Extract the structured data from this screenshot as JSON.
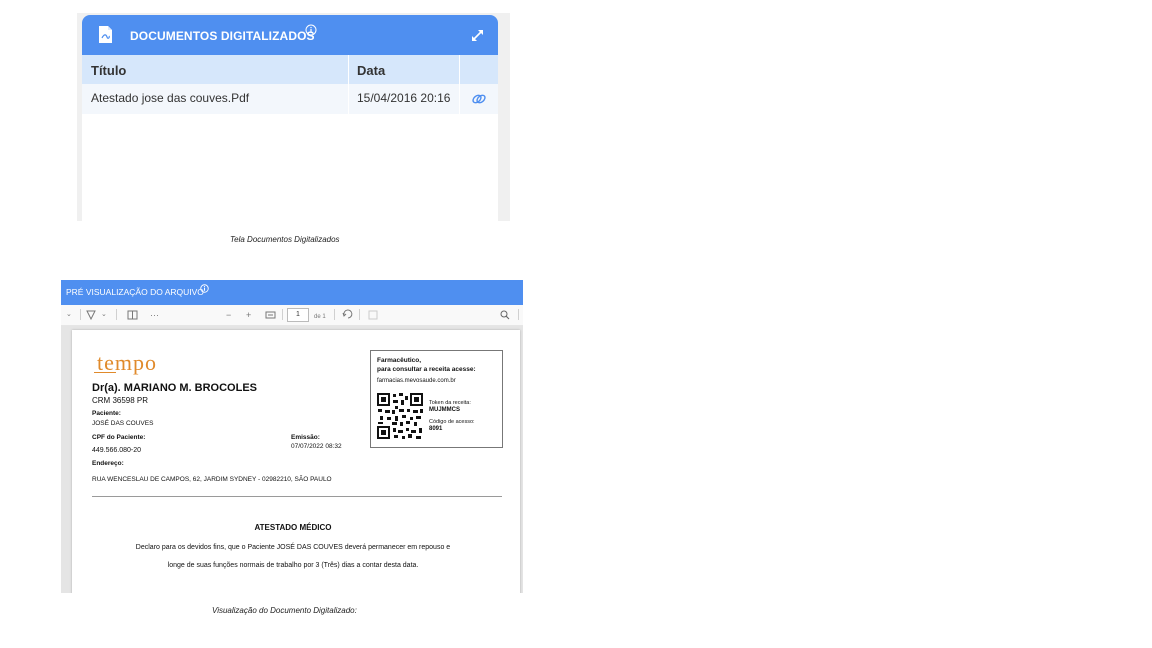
{
  "docs_panel": {
    "title": "DOCUMENTOS DIGITALIZADOS",
    "columns": [
      "Título",
      "Data"
    ],
    "rows": [
      {
        "titulo": "Atestado jose das couves.Pdf",
        "data": "15/04/2016 20:16"
      }
    ],
    "icons": [
      "pdf-file-icon",
      "info-icon",
      "expand-icon",
      "link-icon"
    ],
    "header_color": "#4f8ff0"
  },
  "caption_top": "Tela Documentos Digitalizados",
  "preview": {
    "title": "PRÉ VISUALIZAÇÃO DO ARQUIVO",
    "toolbar": {
      "page_number": "1",
      "page_total": "de 1",
      "minus": "−",
      "plus": "+",
      "more": "···"
    },
    "document": {
      "logo": "tempo",
      "doctor": "Dr(a). MARIANO M. BROCOLES",
      "crm": "CRM 36598 PR",
      "patient_label": "Paciente:",
      "patient": "JOSÉ DAS COUVES",
      "cpf_label": "CPF do Paciente:",
      "cpf": "449.566.080-20",
      "emission_label": "Emissão:",
      "emission": "07/07/2022 08:32",
      "address_label": "Endereço:",
      "address": "RUA WENCESLAU DE CAMPOS, 62, JARDIM SYDNEY - 02982210, SÃO PAULO",
      "pharm_title_1": "Farmacêutico,",
      "pharm_title_2": "para consultar a receita acesse:",
      "pharm_url": "farmacias.mevosaude.com.br",
      "token_label": "Token da receita:",
      "token": "MUJMMCS",
      "code_label": "Código de acesso:",
      "code": "8091",
      "heading": "ATESTADO MÉDICO",
      "body_line_1": "Declaro para os devidos fins, que o Paciente JOSÉ DAS COUVES deverá permanecer em repouso e",
      "body_line_2": "longe de suas funções normais de trabalho por 3 (Três) dias a contar desta data."
    }
  },
  "caption_bottom": "Visualização do Documento Digitalizado:"
}
